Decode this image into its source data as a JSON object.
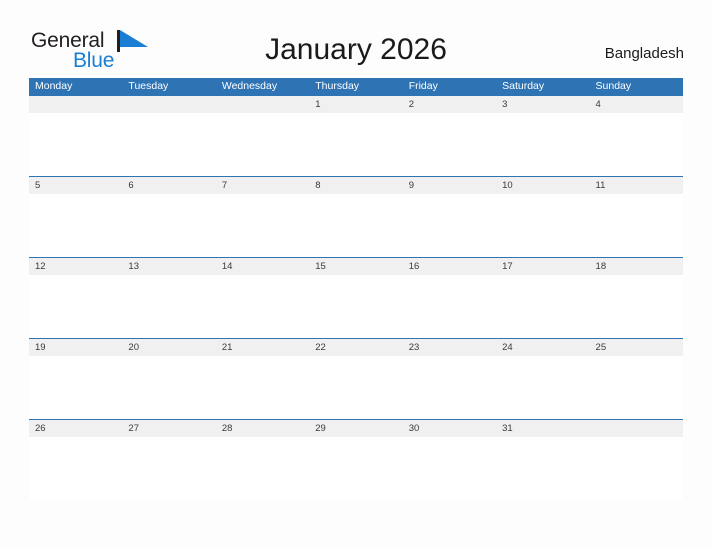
{
  "header": {
    "logo": {
      "line1": "General",
      "line2": "Blue",
      "icon": "flag-triangle-icon",
      "color_dark": "#231f20",
      "color_blue": "#1a7fd4"
    },
    "title": "January 2026",
    "country": "Bangladesh"
  },
  "theme": {
    "header_blue": "#2e74b5",
    "row_band_gray": "#f0f0f0",
    "page_background": "#fdfdfd",
    "text_dark": "#1a1a1a",
    "daynum_text": "#3a3a3a",
    "weekday_text": "#ffffff"
  },
  "calendar": {
    "month": "January",
    "year": "2026",
    "weekdays": [
      "Monday",
      "Tuesday",
      "Wednesday",
      "Thursday",
      "Friday",
      "Saturday",
      "Sunday"
    ],
    "weeks": [
      [
        "",
        "",
        "",
        "1",
        "2",
        "3",
        "4"
      ],
      [
        "5",
        "6",
        "7",
        "8",
        "9",
        "10",
        "11"
      ],
      [
        "12",
        "13",
        "14",
        "15",
        "16",
        "17",
        "18"
      ],
      [
        "19",
        "20",
        "21",
        "22",
        "23",
        "24",
        "25"
      ],
      [
        "26",
        "27",
        "28",
        "29",
        "30",
        "31",
        ""
      ]
    ]
  }
}
